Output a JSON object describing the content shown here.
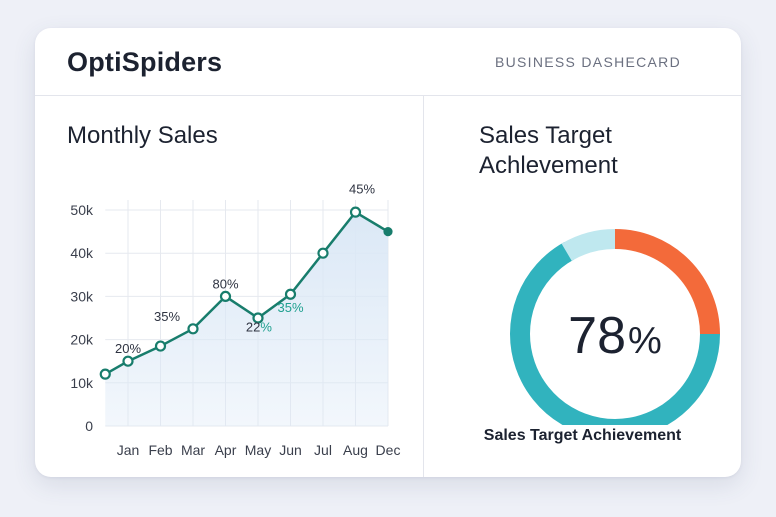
{
  "header": {
    "brand": "OptiSpiders",
    "subtitle": "BUSINESS DASHECARD"
  },
  "sales_panel": {
    "title": "Monthly Sales"
  },
  "target_panel": {
    "title_line1": "Sales Target",
    "title_line2": "Achlevement",
    "caption": "Sales Target Achievement"
  },
  "colors": {
    "line": "#187d6c",
    "area": "#dbe8f6",
    "ring_main": "#31b3be",
    "ring_light": "#bfe8ef",
    "ring_accent": "#f36a3a",
    "text_dark": "#1c2230",
    "teal_label": "#1fa08f"
  },
  "chart_data": [
    {
      "type": "line",
      "title": "Monthly Sales",
      "categories": [
        "Jan",
        "Feb",
        "Mar",
        "Apr",
        "May",
        "Jun",
        "Jul",
        "Aug",
        "Dec"
      ],
      "y_ticks": [
        "0",
        "10k",
        "20k",
        "30k",
        "40k",
        "50k"
      ],
      "ylim": [
        0,
        50000
      ],
      "grid": true,
      "series": [
        {
          "x": [
            -0.7,
            0,
            1,
            2,
            3,
            4,
            5,
            6,
            7,
            8
          ],
          "values": [
            12000,
            15000,
            18500,
            22500,
            30000,
            25000,
            30500,
            40000,
            49500,
            45000
          ]
        }
      ],
      "annotations": [
        {
          "text": "20%",
          "x": 0,
          "y": 15000,
          "color": "dark"
        },
        {
          "text": "35%",
          "x": 1.2,
          "y": 22500,
          "color": "dark"
        },
        {
          "text": "80%",
          "x": 3,
          "y": 30000,
          "color": "dark"
        },
        {
          "text": "22",
          "x": 3.85,
          "y": 20000,
          "color": "dark"
        },
        {
          "text": "%",
          "x": 4.25,
          "y": 20000,
          "color": "teal"
        },
        {
          "text": "35%",
          "x": 5,
          "y": 24500,
          "color": "teal"
        },
        {
          "text": "45%",
          "x": 7.2,
          "y": 52000,
          "color": "dark"
        }
      ]
    },
    {
      "type": "pie",
      "title": "Sales Target Achlevement",
      "center_label": "78%",
      "value": 78,
      "slices": [
        {
          "value": 75,
          "color": "#31b3be"
        },
        {
          "value": 25,
          "color": "#f36a3a"
        }
      ]
    }
  ]
}
